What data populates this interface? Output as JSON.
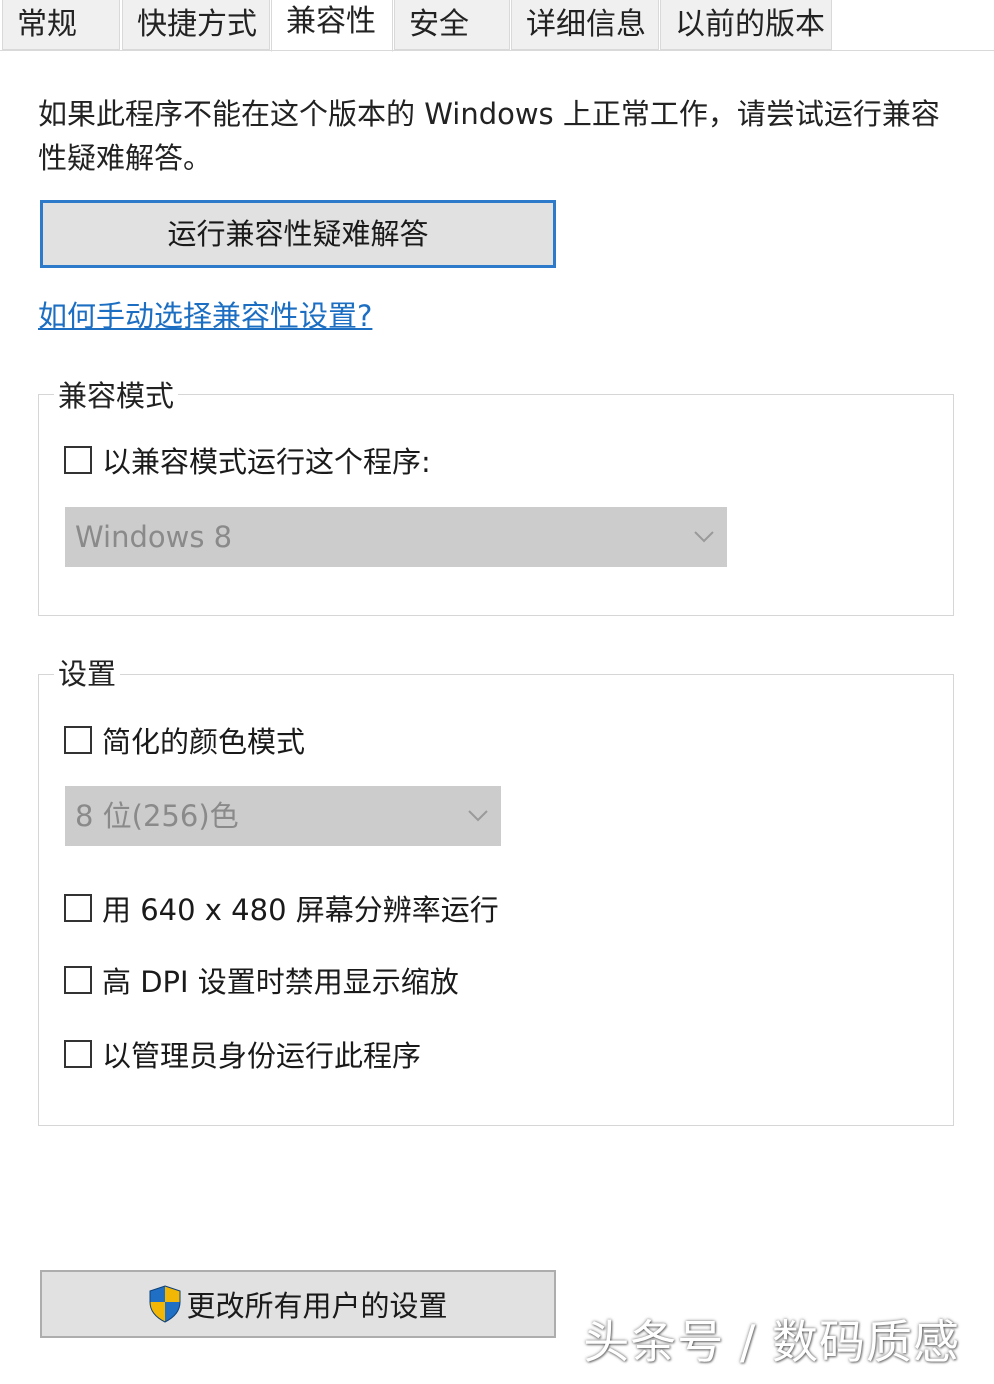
{
  "tabs": [
    {
      "label": "常规",
      "active": false
    },
    {
      "label": "快捷方式",
      "active": false
    },
    {
      "label": "兼容性",
      "active": true
    },
    {
      "label": "安全",
      "active": false
    },
    {
      "label": "详细信息",
      "active": false
    },
    {
      "label": "以前的版本",
      "active": false
    }
  ],
  "intro": {
    "text": "如果此程序不能在这个版本的 Windows 上正常工作，请尝试运行兼容性疑难解答。"
  },
  "troubleshoot_button": "运行兼容性疑难解答",
  "help_link": "如何手动选择兼容性设置?",
  "compat_mode": {
    "title": "兼容模式",
    "checkbox_label": "以兼容模式运行这个程序:",
    "checked": false,
    "os_select": {
      "value": "Windows 8",
      "enabled": false
    }
  },
  "settings": {
    "title": "设置",
    "reduced_color": {
      "label": "简化的颜色模式",
      "checked": false
    },
    "color_select": {
      "value": "8 位(256)色",
      "enabled": false
    },
    "low_res": {
      "label": "用 640 x 480 屏幕分辨率运行",
      "checked": false
    },
    "disable_dpi": {
      "label": "高 DPI 设置时禁用显示缩放",
      "checked": false
    },
    "run_as_admin": {
      "label": "以管理员身份运行此程序",
      "checked": false
    }
  },
  "all_users_button": {
    "label": "更改所有用户的设置",
    "icon": "uac-shield-icon"
  },
  "watermark": "头条号 / 数码质感",
  "colors": {
    "accent_border": "#2c7ac9",
    "link": "#1b6ec2",
    "disabled_select_bg": "#cccccc",
    "button_bg": "#e1e1e1"
  }
}
